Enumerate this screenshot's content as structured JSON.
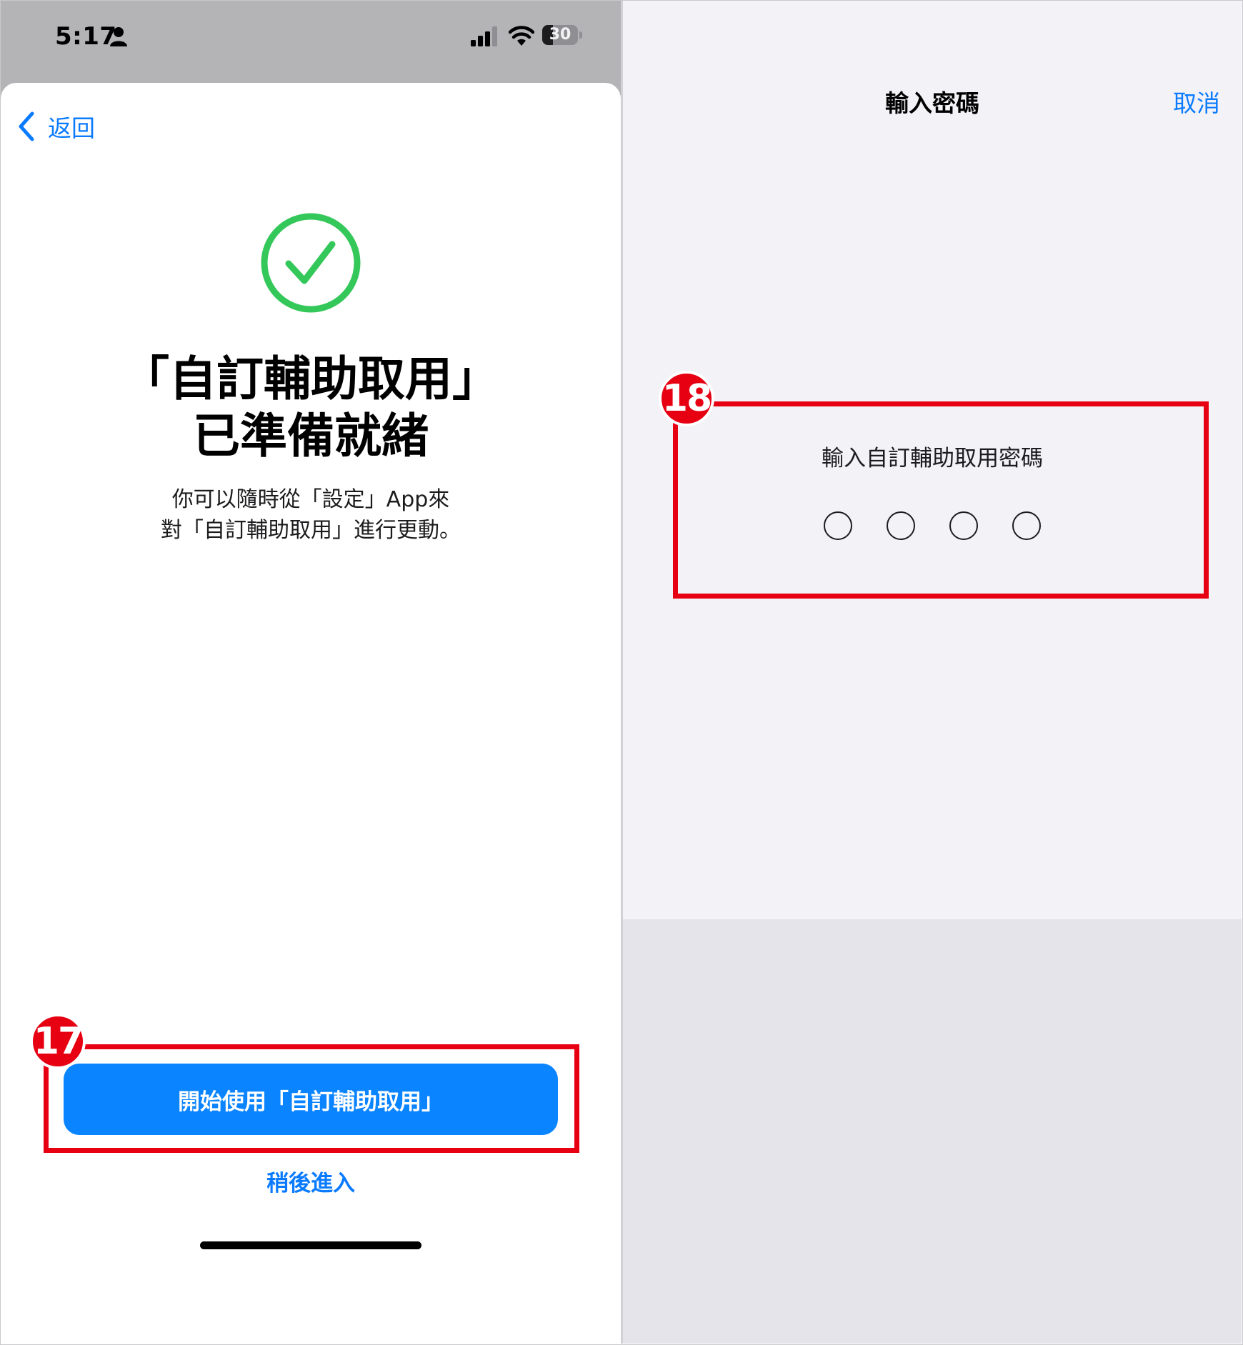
{
  "left_screen": {
    "status_bar": {
      "time": "5:17",
      "battery_level": "30",
      "battery_fraction": 0.3
    },
    "nav": {
      "back_label": "返回"
    },
    "title_line1": "「自訂輔助取用」",
    "title_line2": "已準備就緒",
    "description_line1": "你可以隨時從「設定」App來",
    "description_line2": "對「自訂輔助取用」進行更動。",
    "primary_button": "開始使用「自訂輔助取用」",
    "secondary_button": "稍後進入",
    "callout_number": "17"
  },
  "right_screen": {
    "nav_title": "輸入密碼",
    "cancel_label": "取消",
    "prompt": "輸入自訂輔助取用密碼",
    "passcode_length": 4,
    "passcode_entered": 0,
    "callout_number": "18"
  },
  "colors": {
    "accent_blue": "#0a7aff",
    "button_blue": "#0a84ff",
    "success_green": "#34c759",
    "callout_red": "#e60012"
  },
  "icons": {
    "back": "chevron-left-icon",
    "success": "checkmark-circle-icon",
    "status": [
      "person-icon",
      "cellular-signal-icon",
      "wifi-icon",
      "battery-icon"
    ]
  }
}
